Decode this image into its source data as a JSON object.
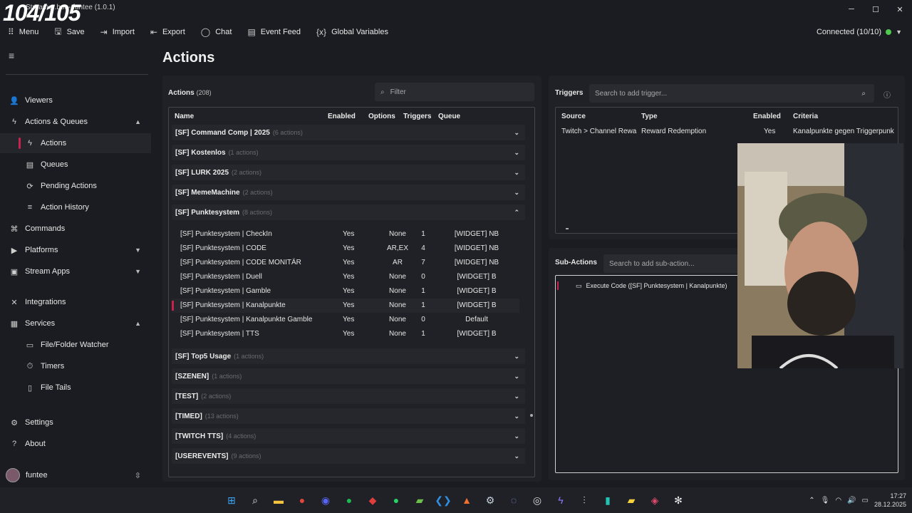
{
  "overlay": {
    "counter": "104/105"
  },
  "window": {
    "title": "Streamer.bot - funtee (1.0.1)",
    "minimize": "─",
    "maximize": "☐",
    "close": "✕"
  },
  "toolbar": {
    "items": [
      {
        "icon": "grid-icon",
        "glyph": "⠿",
        "label": "Menu"
      },
      {
        "icon": "save-icon",
        "glyph": "🖫",
        "label": "Save"
      },
      {
        "icon": "import-icon",
        "glyph": "⇥",
        "label": "Import"
      },
      {
        "icon": "export-icon",
        "glyph": "⇤",
        "label": "Export"
      },
      {
        "icon": "chat-icon",
        "glyph": "◯",
        "label": "Chat"
      },
      {
        "icon": "feed-icon",
        "glyph": "▤",
        "label": "Event Feed"
      },
      {
        "icon": "variables-icon",
        "glyph": "{x}",
        "label": "Global Variables"
      }
    ],
    "status": "Connected (10/10)",
    "status_color": "#4ec94e"
  },
  "sidebar": {
    "items": [
      {
        "label": "Viewers",
        "icon": "users-icon",
        "glyph": "👤"
      },
      {
        "label": "Actions & Queues",
        "icon": "bolt-icon",
        "glyph": "ϟ",
        "chevron": "▲"
      },
      {
        "label": "Actions",
        "icon": "bolt-icon",
        "glyph": "ϟ"
      },
      {
        "label": "Queues",
        "icon": "queue-icon",
        "glyph": "▤"
      },
      {
        "label": "Pending Actions",
        "icon": "pending-icon",
        "glyph": "⟳"
      },
      {
        "label": "Action History",
        "icon": "history-icon",
        "glyph": "≡"
      },
      {
        "label": "Commands",
        "icon": "command-icon",
        "glyph": "⌘"
      },
      {
        "label": "Platforms",
        "icon": "platform-icon",
        "glyph": "▶",
        "chevron": "▼"
      },
      {
        "label": "Stream Apps",
        "icon": "apps-icon",
        "glyph": "▣",
        "chevron": "▼"
      },
      {
        "label": "Integrations",
        "icon": "integrations-icon",
        "glyph": "✕"
      },
      {
        "label": "Services",
        "icon": "services-icon",
        "glyph": "▦",
        "chevron": "▲"
      },
      {
        "label": "File/Folder Watcher",
        "icon": "folder-icon",
        "glyph": "▭"
      },
      {
        "label": "Timers",
        "icon": "timer-icon",
        "glyph": "⏱"
      },
      {
        "label": "File Tails",
        "icon": "file-icon",
        "glyph": "▯"
      },
      {
        "label": "Settings",
        "icon": "settings-icon",
        "glyph": "⚙"
      },
      {
        "label": "About",
        "icon": "help-icon",
        "glyph": "?"
      }
    ],
    "user": "funtee",
    "user_chevron": "⇳",
    "burger": "≡"
  },
  "main": {
    "title": "Actions"
  },
  "actions": {
    "header": "Actions",
    "count": "(208)",
    "filter_placeholder": "Filter",
    "columns": [
      "Name",
      "Enabled",
      "Options",
      "Triggers",
      "Queue"
    ],
    "groups": [
      {
        "name": "[SF] Command Comp | 2025",
        "sub": "(6 actions)",
        "chev": "⌄"
      },
      {
        "name": "[SF] Kostenlos",
        "sub": "(1 actions)",
        "chev": "⌄"
      },
      {
        "name": "[SF] LURK 2025",
        "sub": "(2 actions)",
        "chev": "⌄"
      },
      {
        "name": "[SF] MemeMachine",
        "sub": "(2 actions)",
        "chev": "⌄"
      },
      {
        "name": "[SF] Punktesystem",
        "sub": "(8 actions)",
        "chev": "⌃"
      },
      {
        "name": "[SF] Top5 Usage",
        "sub": "(1 actions)",
        "chev": "⌄"
      },
      {
        "name": "[SZENEN]",
        "sub": "(1 actions)",
        "chev": "⌄"
      },
      {
        "name": "[TEST]",
        "sub": "(2 actions)",
        "chev": "⌄"
      },
      {
        "name": "[TIMED]",
        "sub": "(13 actions)",
        "chev": "⌄"
      },
      {
        "name": "[TWITCH TTS]",
        "sub": "(4 actions)",
        "chev": "⌄"
      },
      {
        "name": "[USEREVENTS]",
        "sub": "(9 actions)",
        "chev": "⌄"
      }
    ],
    "rows": [
      {
        "name": "[SF] Punktesystem | CheckIn",
        "enabled": "Yes",
        "options": "None",
        "triggers": "1",
        "queue": "[WIDGET] NB"
      },
      {
        "name": "[SF] Punktesystem | CODE",
        "enabled": "Yes",
        "options": "AR,EX",
        "triggers": "4",
        "queue": "[WIDGET] NB"
      },
      {
        "name": "[SF] Punktesystem | CODE MONITÄR",
        "enabled": "Yes",
        "options": "AR",
        "triggers": "7",
        "queue": "[WIDGET] NB"
      },
      {
        "name": "[SF] Punktesystem | Duell",
        "enabled": "Yes",
        "options": "None",
        "triggers": "0",
        "queue": "[WIDGET] B"
      },
      {
        "name": "[SF] Punktesystem | Gamble",
        "enabled": "Yes",
        "options": "None",
        "triggers": "1",
        "queue": "[WIDGET] B"
      },
      {
        "name": "[SF] Punktesystem | Kanalpunkte",
        "enabled": "Yes",
        "options": "None",
        "triggers": "1",
        "queue": "[WIDGET] B"
      },
      {
        "name": "[SF] Punktesystem | Kanalpunkte Gamble",
        "enabled": "Yes",
        "options": "None",
        "triggers": "0",
        "queue": "Default"
      },
      {
        "name": "[SF] Punktesystem | TTS",
        "enabled": "Yes",
        "options": "None",
        "triggers": "1",
        "queue": "[WIDGET] B"
      }
    ]
  },
  "triggers": {
    "header": "Triggers",
    "search_placeholder": "Search to add trigger...",
    "search_glyph": "🔍",
    "info_glyph": "ⓘ",
    "columns": [
      "Source",
      "Type",
      "Enabled",
      "Criteria"
    ],
    "rows": [
      {
        "source": "Twitch > Channel Rewa",
        "type": "Reward Redemption",
        "enabled": "Yes",
        "criteria": "Kanalpunkte gegen Triggerpunkte"
      }
    ]
  },
  "subactions": {
    "header": "Sub-Actions",
    "search_placeholder": "Search to add sub-action...",
    "items": [
      {
        "label": "Execute Code ([SF] Punktesystem | Kanalpunkte)",
        "glyph": "▭"
      }
    ]
  },
  "taskbar": {
    "apps": [
      {
        "name": "windows-start-icon",
        "glyph": "⊞",
        "color": "#3ba3f0"
      },
      {
        "name": "search-icon",
        "glyph": "⌕",
        "color": "#e6e6e6"
      },
      {
        "name": "file-explorer-icon",
        "glyph": "▬",
        "color": "#f3c33e"
      },
      {
        "name": "chrome-icon",
        "glyph": "●",
        "color": "#e0463a"
      },
      {
        "name": "discord-icon",
        "glyph": "◉",
        "color": "#5865f2"
      },
      {
        "name": "spotify-icon",
        "glyph": "●",
        "color": "#1db954"
      },
      {
        "name": "app-red-icon",
        "glyph": "◆",
        "color": "#e23d3d"
      },
      {
        "name": "whatsapp-icon",
        "glyph": "●",
        "color": "#25d366"
      },
      {
        "name": "app-green-icon",
        "glyph": "▰",
        "color": "#6cc04a"
      },
      {
        "name": "vscode-icon",
        "glyph": "❮❯",
        "color": "#2f8fe0"
      },
      {
        "name": "app-orange-icon",
        "glyph": "▲",
        "color": "#f07030"
      },
      {
        "name": "steam-icon",
        "glyph": "⚙",
        "color": "#c6d4df"
      },
      {
        "name": "app-blue-icon",
        "glyph": "◌",
        "color": "#7aa0e0"
      },
      {
        "name": "obs-icon",
        "glyph": "◎",
        "color": "#dddddd"
      },
      {
        "name": "streamerbot-icon",
        "glyph": "ϟ",
        "color": "#8a7cff"
      },
      {
        "name": "audio-icon",
        "glyph": "⫶",
        "color": "#dddddd"
      },
      {
        "name": "app-teal-icon",
        "glyph": "▮",
        "color": "#22c3b0"
      },
      {
        "name": "notes-icon",
        "glyph": "▰",
        "color": "#f5d13a"
      },
      {
        "name": "davinci-icon",
        "glyph": "◈",
        "color": "#e04a6a"
      },
      {
        "name": "chatgpt-icon",
        "glyph": "✻",
        "color": "#e6e6e6"
      }
    ],
    "tray": {
      "chevron": "⌃",
      "mic": "🎙",
      "wifi": "◠",
      "volume": "🔊",
      "battery": "▭",
      "time": "17:27",
      "date": "28.12.2025"
    }
  }
}
